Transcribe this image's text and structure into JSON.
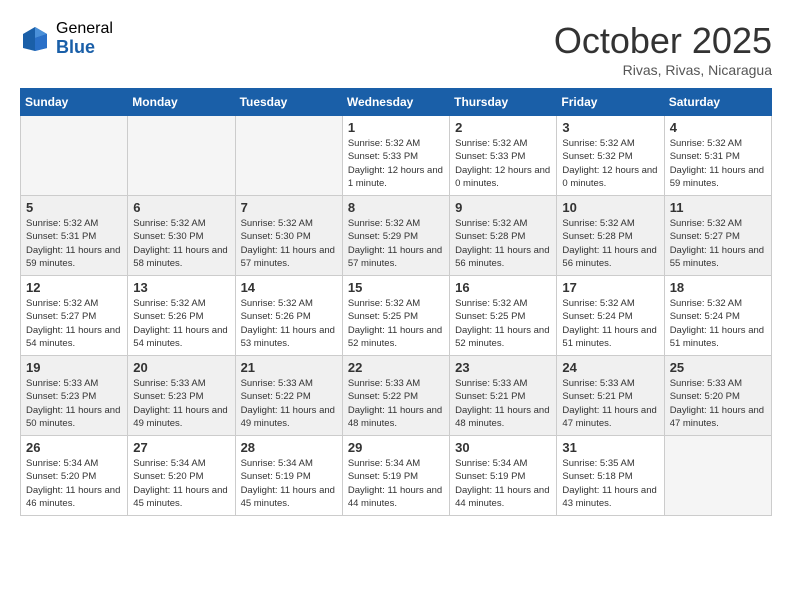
{
  "header": {
    "logo_general": "General",
    "logo_blue": "Blue",
    "month_title": "October 2025",
    "subtitle": "Rivas, Rivas, Nicaragua"
  },
  "days_of_week": [
    "Sunday",
    "Monday",
    "Tuesday",
    "Wednesday",
    "Thursday",
    "Friday",
    "Saturday"
  ],
  "weeks": [
    [
      {
        "day": "",
        "info": ""
      },
      {
        "day": "",
        "info": ""
      },
      {
        "day": "",
        "info": ""
      },
      {
        "day": "1",
        "info": "Sunrise: 5:32 AM\nSunset: 5:33 PM\nDaylight: 12 hours\nand 1 minute."
      },
      {
        "day": "2",
        "info": "Sunrise: 5:32 AM\nSunset: 5:33 PM\nDaylight: 12 hours\nand 0 minutes."
      },
      {
        "day": "3",
        "info": "Sunrise: 5:32 AM\nSunset: 5:32 PM\nDaylight: 12 hours\nand 0 minutes."
      },
      {
        "day": "4",
        "info": "Sunrise: 5:32 AM\nSunset: 5:31 PM\nDaylight: 11 hours\nand 59 minutes."
      }
    ],
    [
      {
        "day": "5",
        "info": "Sunrise: 5:32 AM\nSunset: 5:31 PM\nDaylight: 11 hours\nand 59 minutes."
      },
      {
        "day": "6",
        "info": "Sunrise: 5:32 AM\nSunset: 5:30 PM\nDaylight: 11 hours\nand 58 minutes."
      },
      {
        "day": "7",
        "info": "Sunrise: 5:32 AM\nSunset: 5:30 PM\nDaylight: 11 hours\nand 57 minutes."
      },
      {
        "day": "8",
        "info": "Sunrise: 5:32 AM\nSunset: 5:29 PM\nDaylight: 11 hours\nand 57 minutes."
      },
      {
        "day": "9",
        "info": "Sunrise: 5:32 AM\nSunset: 5:28 PM\nDaylight: 11 hours\nand 56 minutes."
      },
      {
        "day": "10",
        "info": "Sunrise: 5:32 AM\nSunset: 5:28 PM\nDaylight: 11 hours\nand 56 minutes."
      },
      {
        "day": "11",
        "info": "Sunrise: 5:32 AM\nSunset: 5:27 PM\nDaylight: 11 hours\nand 55 minutes."
      }
    ],
    [
      {
        "day": "12",
        "info": "Sunrise: 5:32 AM\nSunset: 5:27 PM\nDaylight: 11 hours\nand 54 minutes."
      },
      {
        "day": "13",
        "info": "Sunrise: 5:32 AM\nSunset: 5:26 PM\nDaylight: 11 hours\nand 54 minutes."
      },
      {
        "day": "14",
        "info": "Sunrise: 5:32 AM\nSunset: 5:26 PM\nDaylight: 11 hours\nand 53 minutes."
      },
      {
        "day": "15",
        "info": "Sunrise: 5:32 AM\nSunset: 5:25 PM\nDaylight: 11 hours\nand 52 minutes."
      },
      {
        "day": "16",
        "info": "Sunrise: 5:32 AM\nSunset: 5:25 PM\nDaylight: 11 hours\nand 52 minutes."
      },
      {
        "day": "17",
        "info": "Sunrise: 5:32 AM\nSunset: 5:24 PM\nDaylight: 11 hours\nand 51 minutes."
      },
      {
        "day": "18",
        "info": "Sunrise: 5:32 AM\nSunset: 5:24 PM\nDaylight: 11 hours\nand 51 minutes."
      }
    ],
    [
      {
        "day": "19",
        "info": "Sunrise: 5:33 AM\nSunset: 5:23 PM\nDaylight: 11 hours\nand 50 minutes."
      },
      {
        "day": "20",
        "info": "Sunrise: 5:33 AM\nSunset: 5:23 PM\nDaylight: 11 hours\nand 49 minutes."
      },
      {
        "day": "21",
        "info": "Sunrise: 5:33 AM\nSunset: 5:22 PM\nDaylight: 11 hours\nand 49 minutes."
      },
      {
        "day": "22",
        "info": "Sunrise: 5:33 AM\nSunset: 5:22 PM\nDaylight: 11 hours\nand 48 minutes."
      },
      {
        "day": "23",
        "info": "Sunrise: 5:33 AM\nSunset: 5:21 PM\nDaylight: 11 hours\nand 48 minutes."
      },
      {
        "day": "24",
        "info": "Sunrise: 5:33 AM\nSunset: 5:21 PM\nDaylight: 11 hours\nand 47 minutes."
      },
      {
        "day": "25",
        "info": "Sunrise: 5:33 AM\nSunset: 5:20 PM\nDaylight: 11 hours\nand 47 minutes."
      }
    ],
    [
      {
        "day": "26",
        "info": "Sunrise: 5:34 AM\nSunset: 5:20 PM\nDaylight: 11 hours\nand 46 minutes."
      },
      {
        "day": "27",
        "info": "Sunrise: 5:34 AM\nSunset: 5:20 PM\nDaylight: 11 hours\nand 45 minutes."
      },
      {
        "day": "28",
        "info": "Sunrise: 5:34 AM\nSunset: 5:19 PM\nDaylight: 11 hours\nand 45 minutes."
      },
      {
        "day": "29",
        "info": "Sunrise: 5:34 AM\nSunset: 5:19 PM\nDaylight: 11 hours\nand 44 minutes."
      },
      {
        "day": "30",
        "info": "Sunrise: 5:34 AM\nSunset: 5:19 PM\nDaylight: 11 hours\nand 44 minutes."
      },
      {
        "day": "31",
        "info": "Sunrise: 5:35 AM\nSunset: 5:18 PM\nDaylight: 11 hours\nand 43 minutes."
      },
      {
        "day": "",
        "info": ""
      }
    ]
  ]
}
